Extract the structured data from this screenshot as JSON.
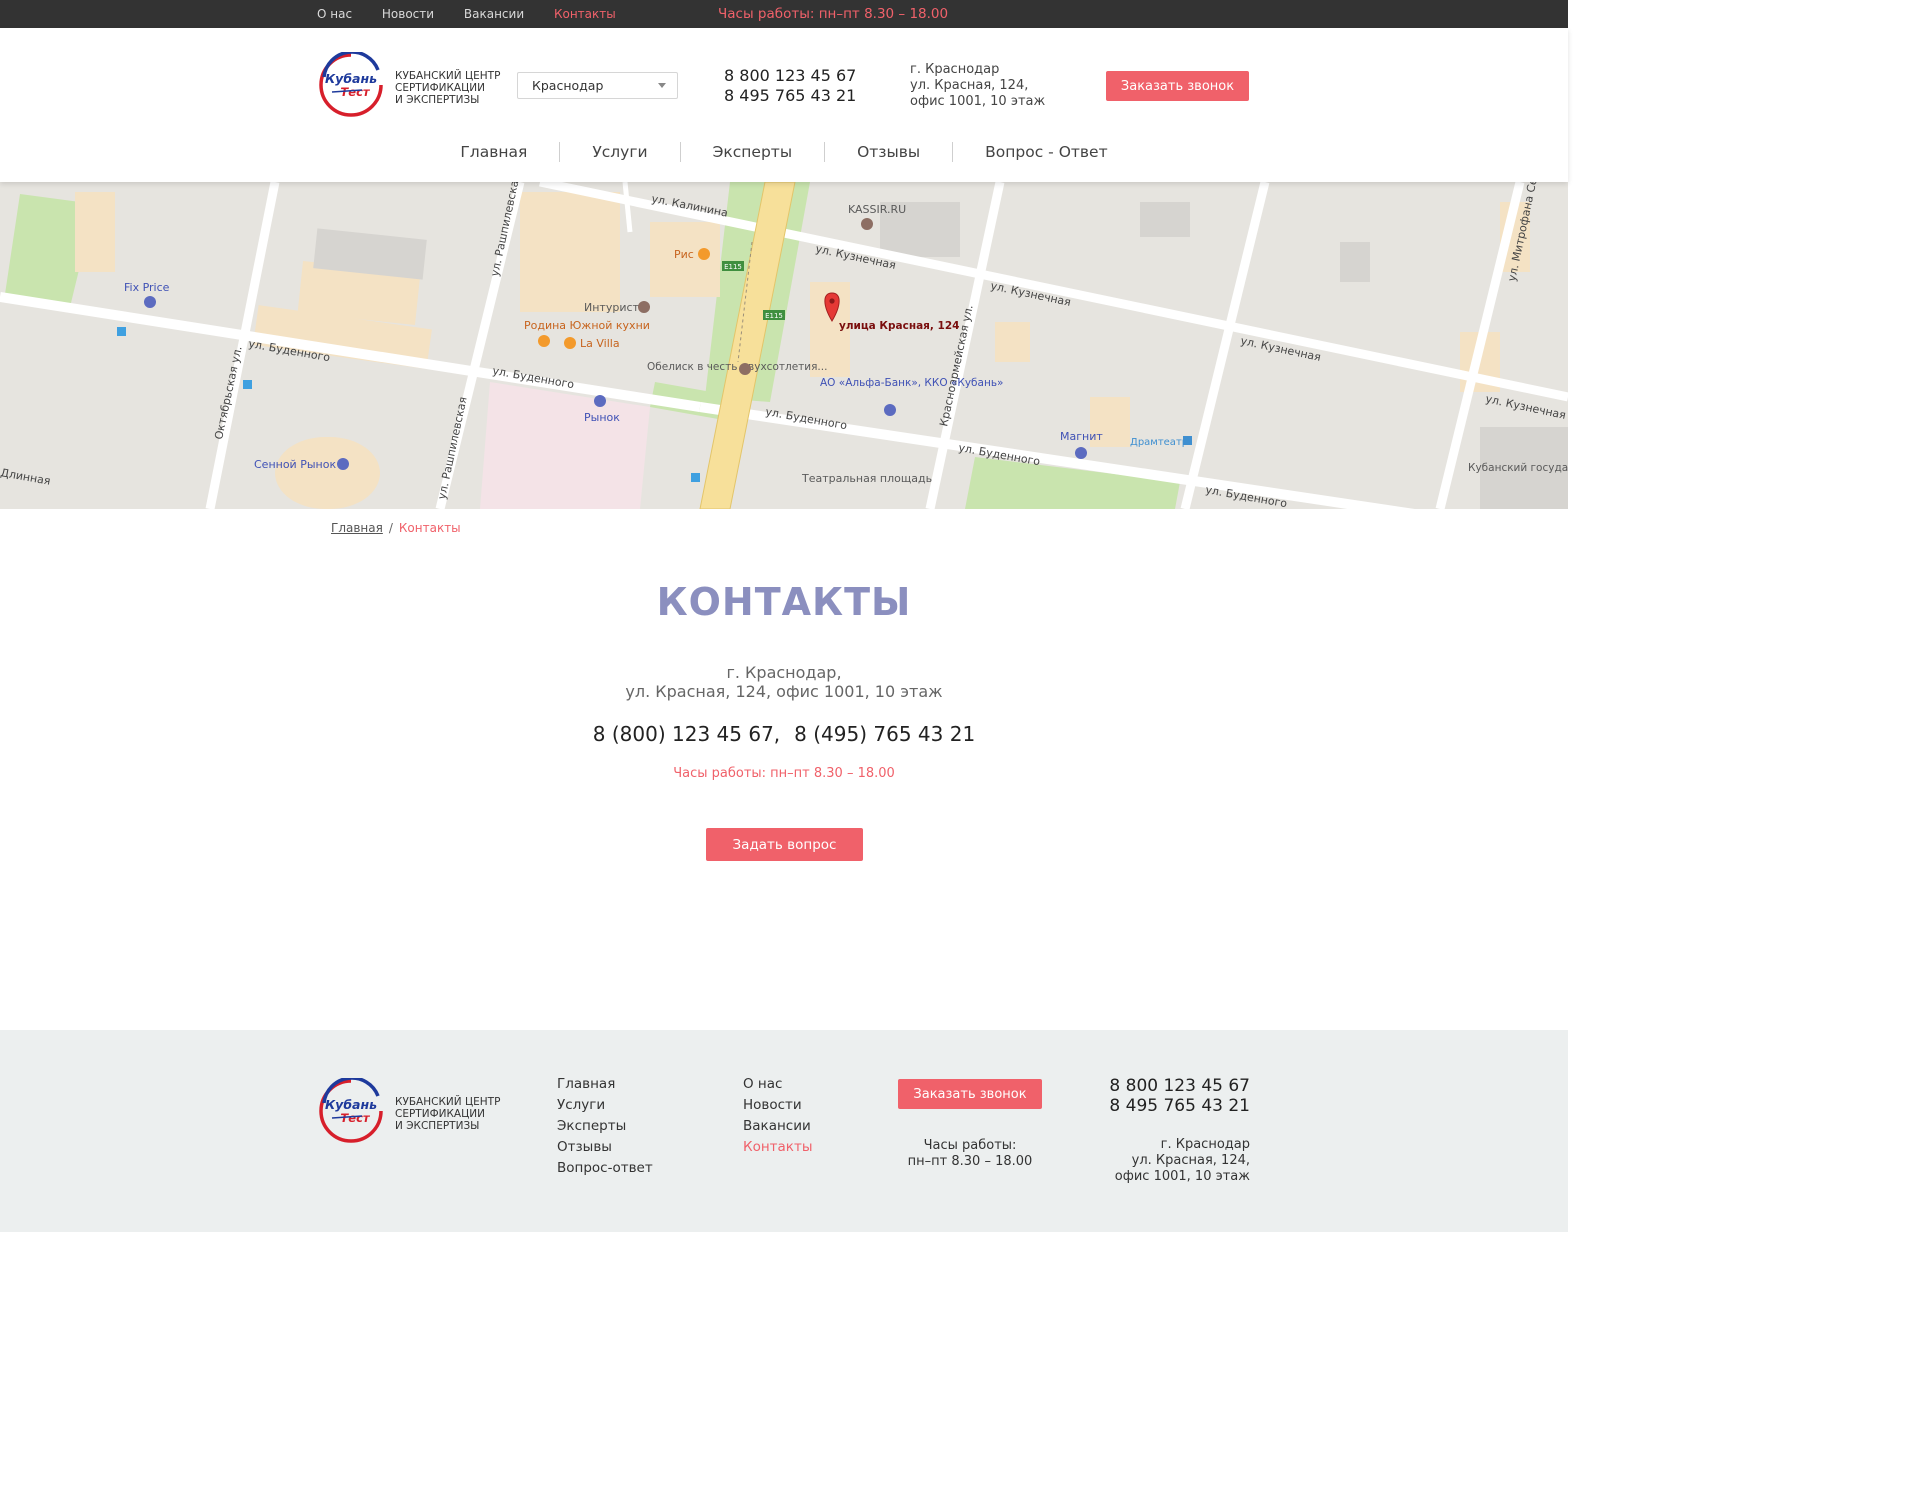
{
  "topbar": {
    "nav": [
      {
        "label": "О нас",
        "active": false
      },
      {
        "label": "Новости",
        "active": false
      },
      {
        "label": "Вакансии",
        "active": false
      },
      {
        "label": "Контакты",
        "active": true
      }
    ],
    "hours": "Часы работы: пн–пт 8.30 – 18.00"
  },
  "header": {
    "logo_word_1": "Кубань",
    "logo_word_2": "Тест",
    "logo_text": [
      "КУБАНСКИЙ ЦЕНТР",
      "СЕРТИФИКАЦИИ",
      "И ЭКСПЕРТИЗЫ"
    ],
    "city_select": "Краснодар",
    "phones": [
      "8 800 123 45 67",
      "8 495 765 43 21"
    ],
    "address": [
      "г. Краснодар",
      "ул. Красная, 124,",
      "офис 1001, 10 этаж"
    ],
    "call_button": "Заказать звонок"
  },
  "main_nav": [
    "Главная",
    "Услуги",
    "Эксперты",
    "Отзывы",
    "Вопрос - Ответ"
  ],
  "map": {
    "marker_label": "улица Красная, 124",
    "labels": [
      "ул. Калинина",
      "KASSIR.RU",
      "ул. Кузнечная",
      "Рис",
      "Fix Price",
      "Интурист",
      "Родина Южной кухни",
      "La Villa",
      "ул. Буденного",
      "Обелиск в честь двухсотлетия...",
      "АО «Альфа-Банк», ККО «Кубань»",
      "Рынок",
      "Сенной Рынок",
      "Магнит",
      "Драмтеатр",
      "Театральная площадь",
      "Кубанский государственный университет физической",
      "ул. Рашпилевская",
      "Октябрьская ул.",
      "Красноармейская ул.",
      "ул. Митрофана Седина",
      "E115",
      "Длинная"
    ]
  },
  "breadcrumb": {
    "home": "Главная",
    "separator": "/",
    "current": "Контакты"
  },
  "contacts": {
    "title": "КОНТАКТЫ",
    "address_line1": "г. Краснодар,",
    "address_line2": "ул. Красная, 124, офис 1001, 10 этаж",
    "phone1": "8 (800) 123 45 67,",
    "phone2": "8 (495) 765 43 21",
    "hours": "Часы работы: пн–пт 8.30 – 18.00",
    "ask_button": "Задать вопрос"
  },
  "footer": {
    "col1": [
      {
        "label": "Главная",
        "active": false
      },
      {
        "label": "Услуги",
        "active": false
      },
      {
        "label": "Эксперты",
        "active": false
      },
      {
        "label": "Отзывы",
        "active": false
      },
      {
        "label": "Вопрос-ответ",
        "active": false
      }
    ],
    "col2": [
      {
        "label": "О нас",
        "active": false
      },
      {
        "label": "Новости",
        "active": false
      },
      {
        "label": "Вакансии",
        "active": false
      },
      {
        "label": "Контакты",
        "active": true
      }
    ],
    "call_button": "Заказать звонок",
    "hours_title": "Часы работы:",
    "hours_value": "пн–пт 8.30 – 18.00",
    "phones": [
      "8 800 123 45 67",
      "8 495 765 43 21"
    ],
    "address": [
      "г. Краснодар",
      "ул. Красная, 124,",
      "офис 1001, 10 этаж"
    ]
  },
  "colors": {
    "accent": "#f0616a",
    "title": "#8b8fbf",
    "topbar": "#333333",
    "footer_bg": "#ecefef"
  }
}
